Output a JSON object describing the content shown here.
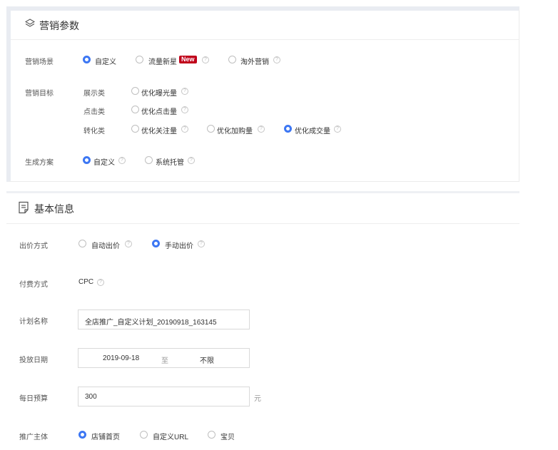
{
  "marketing": {
    "title": "营销参数",
    "scene": {
      "label": "营销场景",
      "options": [
        {
          "label": "自定义",
          "selected": true
        },
        {
          "label": "流量新星",
          "badge": "New",
          "selected": false
        },
        {
          "label": "淘外营销",
          "selected": false
        }
      ]
    },
    "goal": {
      "label": "营销目标",
      "groups": [
        {
          "label": "展示类",
          "options": [
            {
              "label": "优化曝光量",
              "selected": false
            }
          ]
        },
        {
          "label": "点击类",
          "options": [
            {
              "label": "优化点击量",
              "selected": false
            }
          ]
        },
        {
          "label": "转化类",
          "options": [
            {
              "label": "优化关注量",
              "selected": false
            },
            {
              "label": "优化加购量",
              "selected": false
            },
            {
              "label": "优化成交量",
              "selected": true
            }
          ]
        }
      ]
    },
    "plan": {
      "label": "生成方案",
      "options": [
        {
          "label": "自定义",
          "selected": true
        },
        {
          "label": "系统托管",
          "selected": false
        }
      ]
    }
  },
  "basic": {
    "title": "基本信息",
    "bid": {
      "label": "出价方式",
      "options": [
        {
          "label": "自动出价",
          "selected": false
        },
        {
          "label": "手动出价",
          "selected": true
        }
      ]
    },
    "payment": {
      "label": "付费方式",
      "value": "CPC"
    },
    "plan_name": {
      "label": "计划名称",
      "value": "全店推广_自定义计划_20190918_163145"
    },
    "date": {
      "label": "投放日期",
      "start": "2019-09-18",
      "separator": "至",
      "end": "不限"
    },
    "budget": {
      "label": "每日预算",
      "value": "300",
      "unit": "元"
    },
    "subject": {
      "label": "推广主体",
      "options": [
        {
          "label": "店铺首页",
          "selected": true
        },
        {
          "label": "自定义URL",
          "selected": false
        },
        {
          "label": "宝贝",
          "selected": false
        }
      ]
    }
  },
  "colors": {
    "accent": "#3d77f3",
    "badge": "#c0001a"
  },
  "help_glyph": "?"
}
